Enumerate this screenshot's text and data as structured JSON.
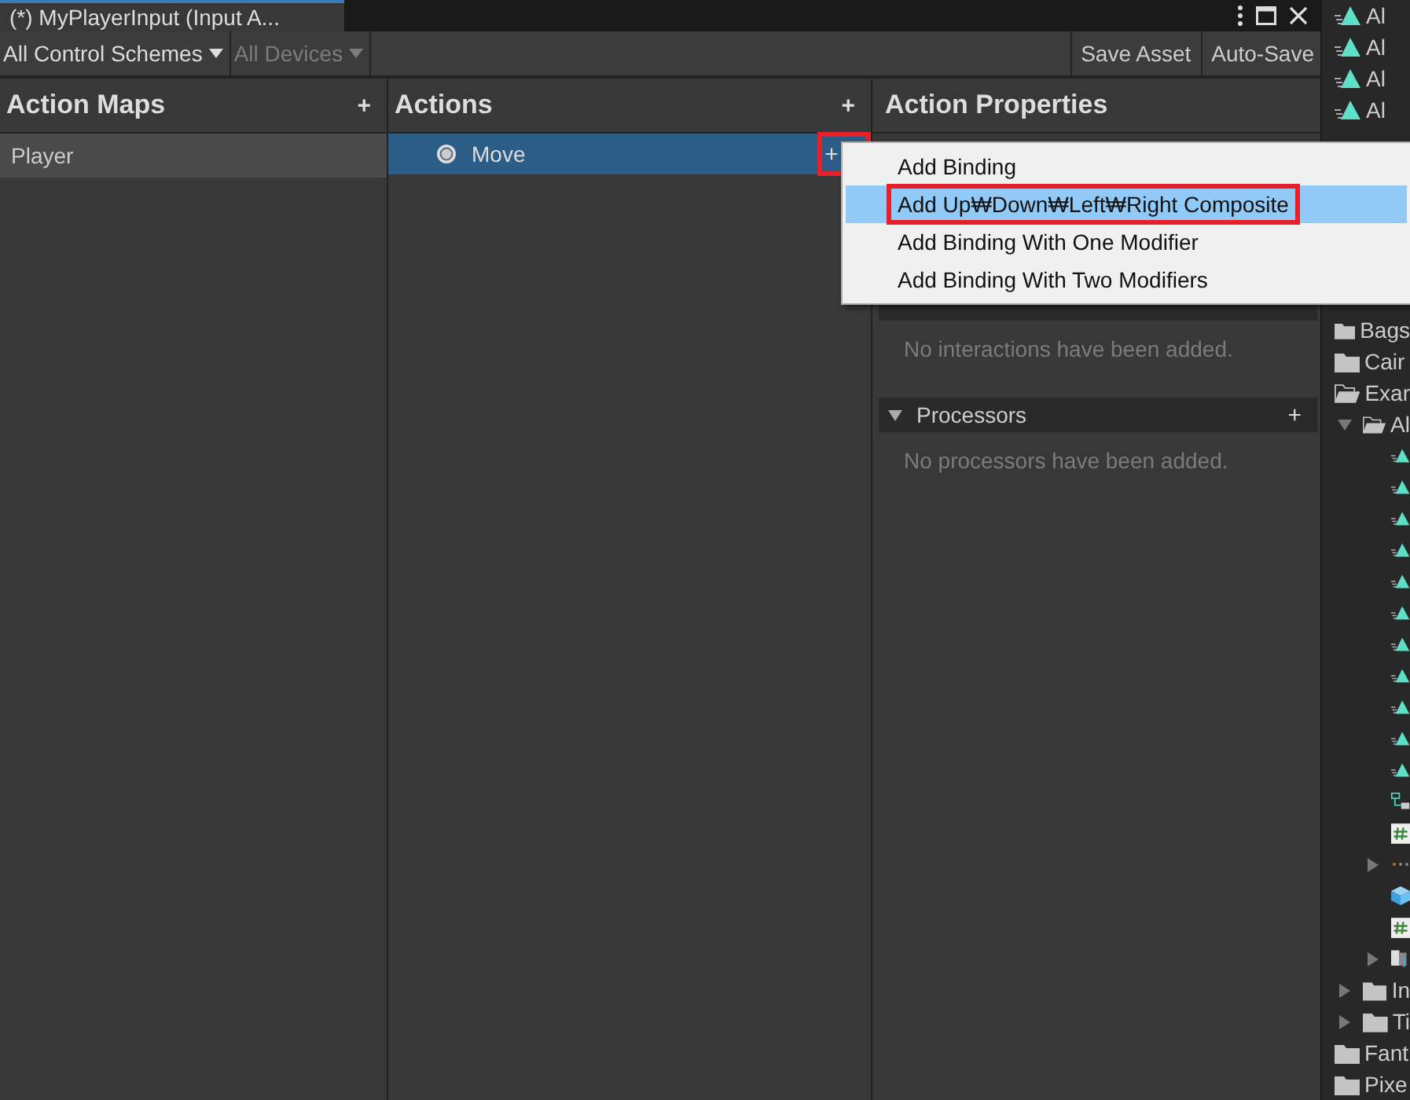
{
  "window": {
    "title": "(*) MyPlayerInput (Input A..."
  },
  "toolbar": {
    "control_schemes": {
      "label": "All Control Schemes",
      "disabled": false
    },
    "devices": {
      "label": "All Devices",
      "disabled": true
    },
    "buttons": [
      {
        "label": "Save Asset",
        "kind": "button"
      },
      {
        "label": "Auto-Save",
        "kind": "toggle"
      }
    ]
  },
  "action_maps": {
    "title": "Action Maps",
    "add": "+",
    "items": [
      {
        "label": "Player",
        "selected": true
      }
    ]
  },
  "actions": {
    "title": "Actions",
    "add": "+",
    "items": [
      {
        "label": "Move",
        "selected": true,
        "add": "+",
        "highlighted": true
      }
    ]
  },
  "properties": {
    "title": "Action Properties",
    "sections": [
      {
        "empty": "No interactions have been added."
      },
      {
        "title": "Processors",
        "add": "+",
        "empty": "No processors have been added."
      }
    ]
  },
  "menu": {
    "items": [
      {
        "label": "Add Binding",
        "selected": false,
        "highlighted": false
      },
      {
        "label": "Add Up₩Down₩Left₩Right Composite",
        "selected": true,
        "highlighted": true
      },
      {
        "label": "Add Binding With One Modifier",
        "selected": false,
        "highlighted": false
      },
      {
        "label": "Add Binding With Two Modifiers",
        "selected": false,
        "highlighted": false
      }
    ]
  },
  "project": {
    "items": [
      {
        "kind": "anim",
        "label": "Al"
      },
      {
        "kind": "anim",
        "label": "Al"
      },
      {
        "kind": "anim",
        "label": "Al"
      },
      {
        "kind": "anim",
        "label": "Al"
      },
      {
        "kind": "gap"
      },
      {
        "kind": "folder",
        "label": "Bags"
      },
      {
        "kind": "folder",
        "label": "Cair"
      },
      {
        "kind": "open-folder",
        "label": "Exar",
        "children": [
          {
            "kind": "open-folder",
            "label": "Al",
            "expanded": true,
            "children": [
              {
                "kind": "anim"
              },
              {
                "kind": "anim"
              },
              {
                "kind": "anim"
              },
              {
                "kind": "anim"
              },
              {
                "kind": "anim"
              },
              {
                "kind": "anim"
              },
              {
                "kind": "anim"
              },
              {
                "kind": "anim"
              },
              {
                "kind": "anim"
              },
              {
                "kind": "anim"
              },
              {
                "kind": "anim"
              },
              {
                "kind": "controller"
              },
              {
                "kind": "script"
              },
              {
                "kind": "dots",
                "expanded": false
              },
              {
                "kind": "cube"
              },
              {
                "kind": "script"
              },
              {
                "kind": "image",
                "expanded": false
              }
            ]
          },
          {
            "kind": "folder",
            "label": "In",
            "expanded": false
          },
          {
            "kind": "folder",
            "label": "Ti",
            "expanded": false
          }
        ]
      },
      {
        "kind": "folder",
        "label": "Fant"
      },
      {
        "kind": "folder",
        "label": "Pixe"
      }
    ]
  }
}
